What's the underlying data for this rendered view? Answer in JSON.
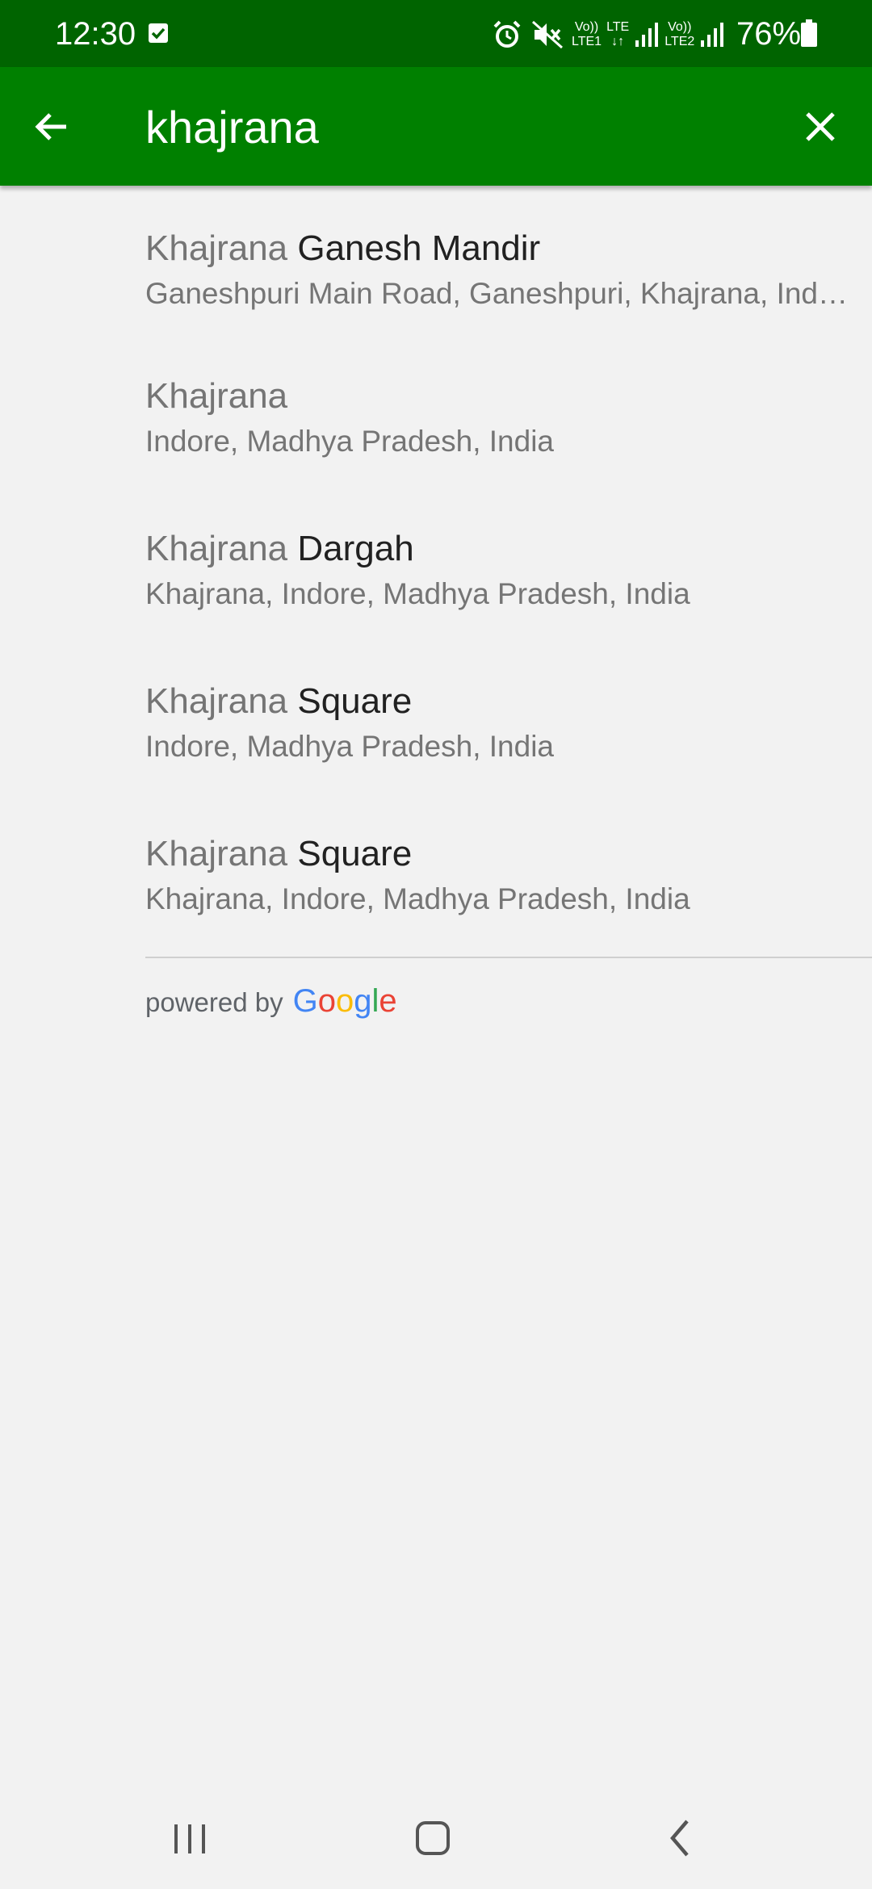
{
  "status_bar": {
    "time": "12:30",
    "battery_text": "76%",
    "icons": [
      "check-notification-icon",
      "alarm-icon",
      "mute-icon",
      "volte-lte1-icon",
      "lte-data-icon",
      "signal-icon",
      "volte-lte2-icon",
      "signal-icon",
      "battery-icon"
    ],
    "volte1_label_top": "Vo))",
    "volte1_label_bottom": "LTE1",
    "lte_label": "LTE",
    "volte2_label_top": "Vo))",
    "volte2_label_bottom": "LTE2"
  },
  "app_bar": {
    "back_icon": "arrow-back-icon",
    "search_value": "khajrana",
    "clear_icon": "close-icon",
    "color": "#008000"
  },
  "results": [
    {
      "match": "Khajrana",
      "rest": " Ganesh Mandir",
      "subtitle": "Ganeshpuri Main Road, Ganeshpuri, Khajrana, Indore, Madhya Pradesh, India"
    },
    {
      "match": "Khajrana",
      "rest": "",
      "subtitle": "Indore, Madhya Pradesh, India"
    },
    {
      "match": "Khajrana",
      "rest": " Dargah",
      "subtitle": "Khajrana, Indore, Madhya Pradesh, India"
    },
    {
      "match": "Khajrana",
      "rest": " Square",
      "subtitle": "Indore, Madhya Pradesh, India"
    },
    {
      "match": "Khajrana",
      "rest": " Square",
      "subtitle": "Khajrana, Indore, Madhya Pradesh, India"
    }
  ],
  "attribution": {
    "powered_by": "powered by",
    "google_letters": [
      "G",
      "o",
      "o",
      "g",
      "l",
      "e"
    ],
    "google_colors": [
      "#4285F4",
      "#EA4335",
      "#FBBC05",
      "#4285F4",
      "#34A853",
      "#EA4335"
    ]
  },
  "nav_bar": {
    "icons": [
      "recent-apps-icon",
      "home-icon",
      "back-icon"
    ]
  }
}
